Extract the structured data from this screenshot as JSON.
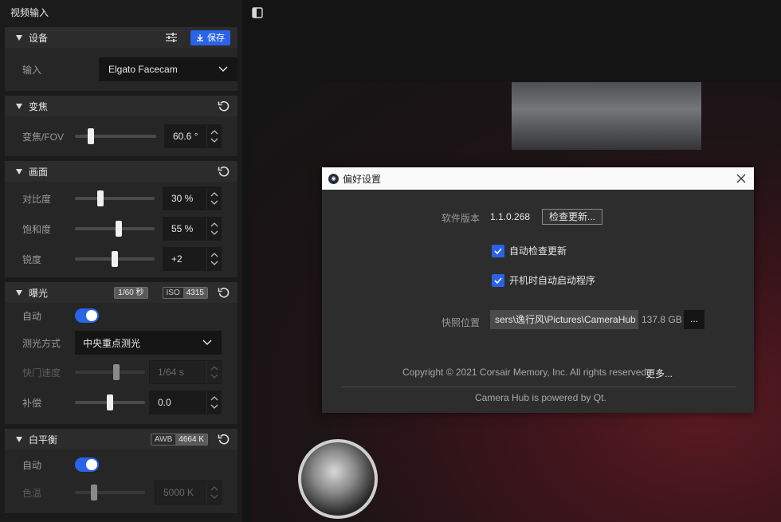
{
  "app": {
    "title": "视频输入"
  },
  "device": {
    "header": "设备",
    "save_label": "保存",
    "input_label": "输入",
    "input_value": "Elgato Facecam"
  },
  "zoom": {
    "header": "变焦",
    "fov_label": "变焦/FOV",
    "fov_value": "60.6 °",
    "fov_level": 0.17
  },
  "image": {
    "header": "画面",
    "contrast_label": "对比度",
    "contrast_value": "30 %",
    "contrast_level": 0.3,
    "saturation_label": "饱和度",
    "saturation_value": "55 %",
    "saturation_level": 0.55,
    "sharpness_label": "锐度",
    "sharpness_value": "+2",
    "sharpness_level": 0.5
  },
  "exposure": {
    "header": "曝光",
    "shutter_badge_value": "1/60 秒",
    "iso_badge_label": "ISO",
    "iso_badge_value": "4315",
    "auto_label": "自动",
    "metering_label": "测光方式",
    "metering_value": "中央重点测光",
    "shutter_label": "快门速度",
    "shutter_value": "1/64 s",
    "shutter_level": 0.6,
    "comp_label": "补偿",
    "comp_value": "0.0",
    "comp_level": 0.5
  },
  "white_balance": {
    "header": "白平衡",
    "awb_badge_label": "AWB",
    "awb_badge_value": "4664 K",
    "auto_label": "自动",
    "temp_label": "色温",
    "temp_value": "5000 K",
    "temp_level": 0.25
  },
  "dialog": {
    "title": "偏好设置",
    "version_label": "软件版本",
    "version_value": "1.1.0.268",
    "check_update_label": "检查更新...",
    "auto_check_label": "自动检查更新",
    "auto_start_label": "开机时自动启动程序",
    "snapshot_label": "快照位置",
    "snapshot_path": "sers\\逸行风\\Pictures\\CameraHub",
    "snapshot_free": "137.8 GB",
    "browse_label": "...",
    "copyright": "Copyright © 2021 Corsair Memory, Inc. All rights reserved.",
    "more_label": "更多...",
    "powered": "Camera Hub is powered by Qt."
  },
  "colors": {
    "accent": "#2a62e8"
  }
}
